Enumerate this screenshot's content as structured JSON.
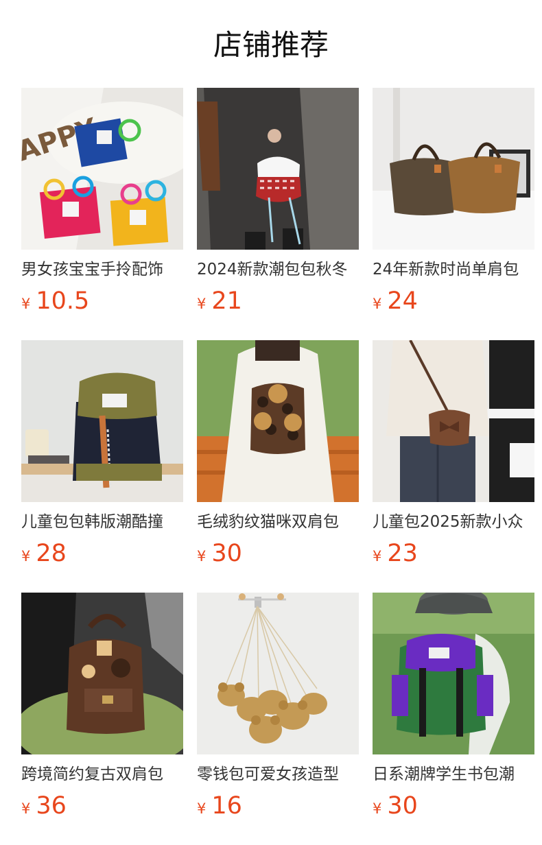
{
  "section_title": "店铺推荐",
  "accent_color": "#e8461c",
  "currency_symbol": "¥",
  "products": [
    {
      "name": "男女孩宝宝手拎配饰",
      "price": "10.5",
      "image": "mesh-tote-bags"
    },
    {
      "name": "2024新款潮包包秋冬",
      "price": "21",
      "image": "plush-drawstring-bag"
    },
    {
      "name": "24年新款时尚单肩包",
      "price": "24",
      "image": "leopard-tote-bags"
    },
    {
      "name": "儿童包包韩版潮酷撞",
      "price": "28",
      "image": "navy-olive-backpack"
    },
    {
      "name": "毛绒豹纹猫咪双肩包",
      "price": "30",
      "image": "leopard-bear-backpack"
    },
    {
      "name": "儿童包2025新款小众",
      "price": "23",
      "image": "brown-bow-handbag"
    },
    {
      "name": "跨境简约复古双肩包",
      "price": "36",
      "image": "brown-leather-backpack"
    },
    {
      "name": "零钱包可爱女孩造型",
      "price": "16",
      "image": "rattan-bear-coin-purses"
    },
    {
      "name": "日系潮牌学生书包潮",
      "price": "30",
      "image": "green-purple-backpack"
    }
  ]
}
